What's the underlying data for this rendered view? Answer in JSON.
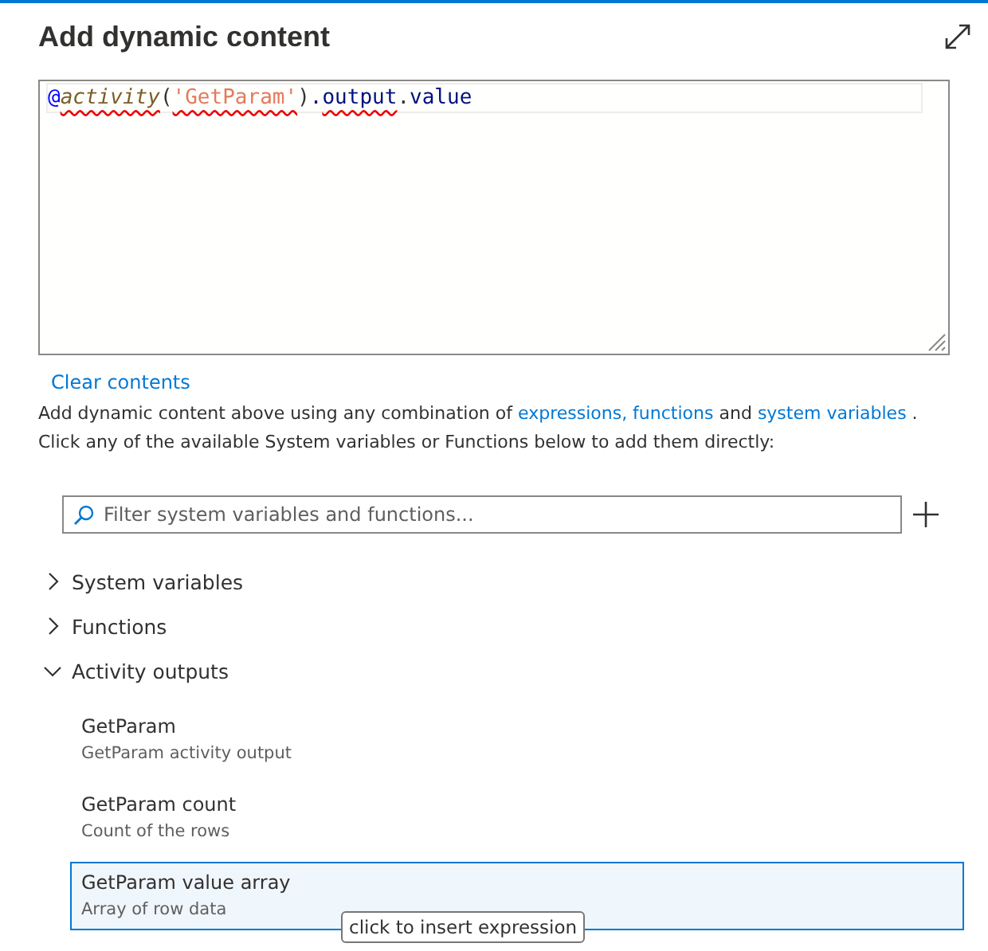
{
  "panel": {
    "title": "Add dynamic content"
  },
  "editor": {
    "tokens": [
      {
        "text": "@",
        "kind": "at",
        "error": false
      },
      {
        "text": "activity",
        "kind": "function",
        "error": true
      },
      {
        "text": "(",
        "kind": "punct",
        "error": false
      },
      {
        "text": "'GetParam'",
        "kind": "string",
        "error": true
      },
      {
        "text": ")",
        "kind": "punct",
        "error": false
      },
      {
        "text": ".",
        "kind": "member",
        "error": false
      },
      {
        "text": "output",
        "kind": "member",
        "error": true
      },
      {
        "text": ".",
        "kind": "punct",
        "error": false
      },
      {
        "text": "value",
        "kind": "member",
        "error": false
      }
    ]
  },
  "clear_link": "Clear contents",
  "help": {
    "lines": [
      [
        {
          "text": "Add dynamic content above using any combination of ",
          "kind": "text"
        },
        {
          "text": "expressions, functions",
          "kind": "link"
        },
        {
          "text": " and ",
          "kind": "text"
        },
        {
          "text": "system variables",
          "kind": "link"
        },
        {
          "text": " .",
          "kind": "text"
        }
      ],
      [
        {
          "text": "Click any of the available System variables or Functions below to add them directly:",
          "kind": "text"
        }
      ]
    ]
  },
  "filter": {
    "placeholder": "Filter system variables and functions..."
  },
  "tree": [
    {
      "label": "System variables",
      "expanded": false
    },
    {
      "label": "Functions",
      "expanded": false
    },
    {
      "label": "Activity outputs",
      "expanded": true,
      "children": [
        {
          "title": "GetParam",
          "description": "GetParam activity output",
          "selected": false
        },
        {
          "title": "GetParam count",
          "description": "Count of the rows",
          "selected": false
        },
        {
          "title": "GetParam value array",
          "description": "Array of row data",
          "selected": true
        }
      ]
    }
  ],
  "tooltip": "click to insert expression"
}
